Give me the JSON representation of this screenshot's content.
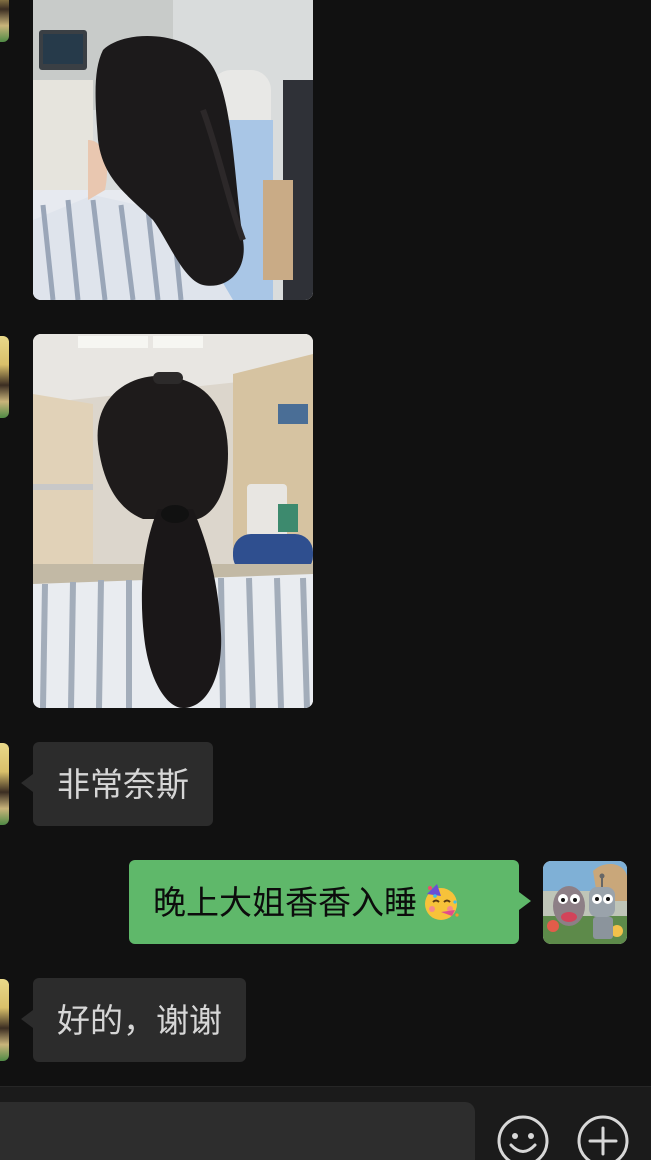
{
  "chat": {
    "messages": [
      {
        "type": "image",
        "sender": "contact",
        "content": "photo-long-hair-hospital-bed"
      },
      {
        "type": "image",
        "sender": "contact",
        "content": "photo-ponytail-hospital-room"
      },
      {
        "type": "text",
        "sender": "contact",
        "text": "非常奈斯"
      },
      {
        "type": "text",
        "sender": "me",
        "text": "晚上大姐香香入睡",
        "emoji": "partying-face-emoji"
      },
      {
        "type": "text",
        "sender": "contact",
        "text": "好的，谢谢"
      }
    ]
  },
  "input_bar": {
    "message_value": "",
    "emoji_button_icon": "smile-icon",
    "plus_button_icon": "plus-icon"
  },
  "colors": {
    "background": "#111111",
    "incoming_bubble": "#2c2c2c",
    "outgoing_bubble": "#5fb86a",
    "input_field": "#2d2d2d"
  }
}
